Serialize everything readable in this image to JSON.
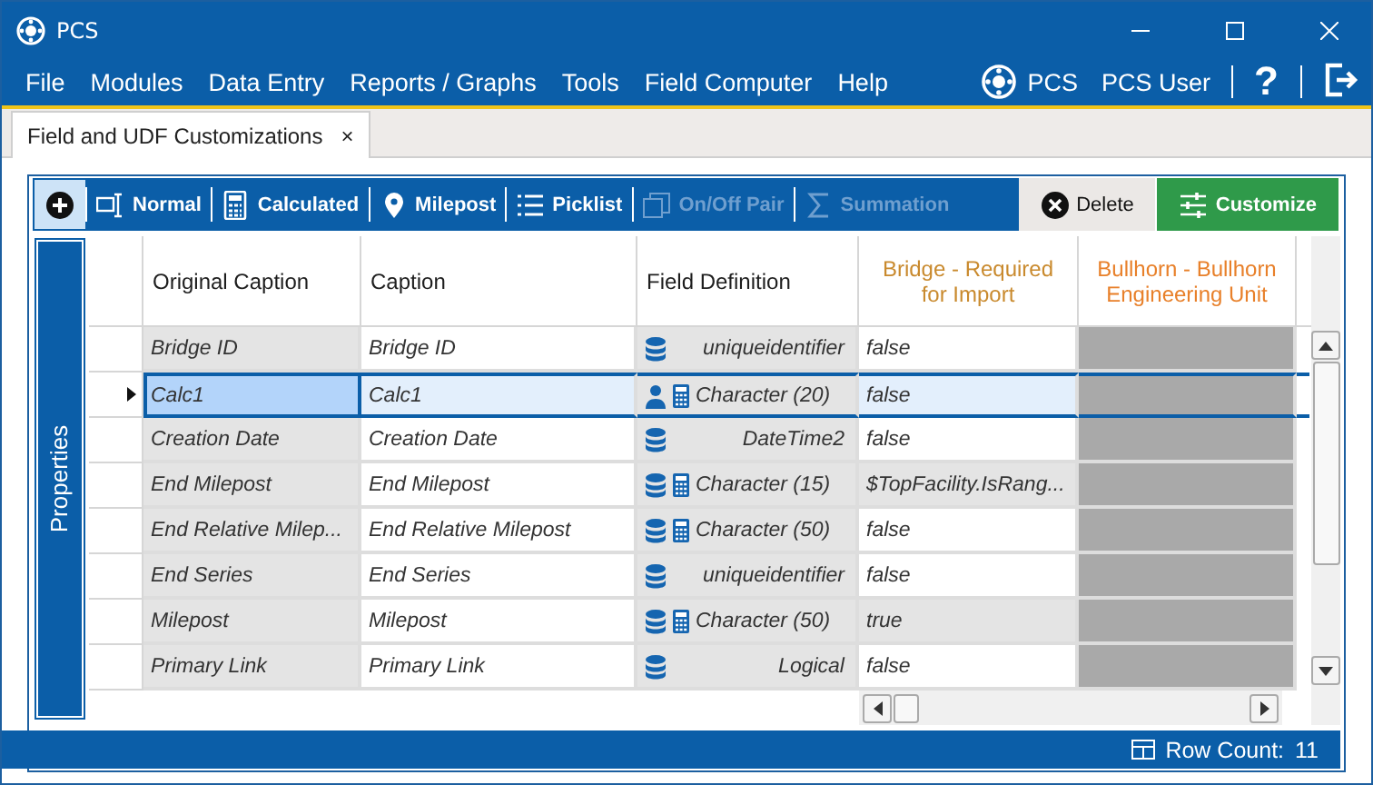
{
  "window": {
    "title": "PCS"
  },
  "menu": [
    "File",
    "Modules",
    "Data Entry",
    "Reports / Graphs",
    "Tools",
    "Field Computer",
    "Help"
  ],
  "user_area": {
    "app": "PCS",
    "user": "PCS User",
    "help": "?"
  },
  "tabs": [
    {
      "label": "Field and UDF Customizations",
      "close": "×",
      "selected": true
    }
  ],
  "toolbar": [
    {
      "kind": "add",
      "selected": true,
      "disabled": false
    },
    {
      "kind": "normal",
      "label": "Normal",
      "disabled": false
    },
    {
      "kind": "calculated",
      "label": "Calculated",
      "disabled": false
    },
    {
      "kind": "milepost",
      "label": "Milepost",
      "disabled": false
    },
    {
      "kind": "picklist",
      "label": "Picklist",
      "disabled": false
    },
    {
      "kind": "onoff",
      "label": "On/Off Pair",
      "disabled": true
    },
    {
      "kind": "summation",
      "label": "Summation",
      "disabled": true
    },
    {
      "kind": "delete",
      "label": "Delete",
      "disabled": false
    },
    {
      "kind": "customize",
      "label": "Customize",
      "disabled": false
    }
  ],
  "side_panel": {
    "label": "Properties"
  },
  "table": {
    "columns": [
      {
        "label": "Original Caption",
        "color": "#1e1e1e"
      },
      {
        "label": "Caption",
        "color": "#1e1e1e"
      },
      {
        "label": "Field Definition",
        "color": "#1e1e1e"
      },
      {
        "label": "Bridge - Required for Import",
        "color": "#c98a2e"
      },
      {
        "label": "Bullhorn - Bullhorn Engineering Unit",
        "color": "#e8802a"
      }
    ],
    "rows": [
      {
        "original": "Bridge ID",
        "caption": "Bridge ID",
        "database": true,
        "user": false,
        "calculated": false,
        "definition": "uniqueidentifier",
        "bridge": "false",
        "bridge_modified": false,
        "selected": false
      },
      {
        "original": "Calc1",
        "caption": "Calc1",
        "database": false,
        "user": true,
        "calculated": true,
        "definition": "Character (20)",
        "bridge": "false",
        "bridge_modified": false,
        "selected": true
      },
      {
        "original": "Creation Date",
        "caption": "Creation Date",
        "database": true,
        "user": false,
        "calculated": false,
        "definition": "DateTime2",
        "bridge": "false",
        "bridge_modified": false,
        "selected": false
      },
      {
        "original": "End Milepost",
        "caption": "End Milepost",
        "database": true,
        "user": false,
        "calculated": true,
        "definition": "Character (15)",
        "bridge": "$TopFacility.IsRang...",
        "bridge_modified": true,
        "selected": false
      },
      {
        "original": "End Relative Milep...",
        "caption": "End Relative Milepost",
        "database": true,
        "user": false,
        "calculated": true,
        "definition": "Character (50)",
        "bridge": "false",
        "bridge_modified": false,
        "selected": false
      },
      {
        "original": "End Series",
        "caption": "End Series",
        "database": true,
        "user": false,
        "calculated": false,
        "definition": "uniqueidentifier",
        "bridge": "false",
        "bridge_modified": false,
        "selected": false
      },
      {
        "original": "Milepost",
        "caption": "Milepost",
        "database": true,
        "user": false,
        "calculated": true,
        "definition": "Character (50)",
        "bridge": "true",
        "bridge_modified": true,
        "selected": false
      },
      {
        "original": "Primary Link",
        "caption": "Primary Link",
        "database": true,
        "user": false,
        "calculated": false,
        "definition": "Logical",
        "bridge": "false",
        "bridge_modified": false,
        "selected": false
      }
    ]
  },
  "status_bar": {
    "row_count_label": "Row Count:",
    "row_count": "11"
  }
}
